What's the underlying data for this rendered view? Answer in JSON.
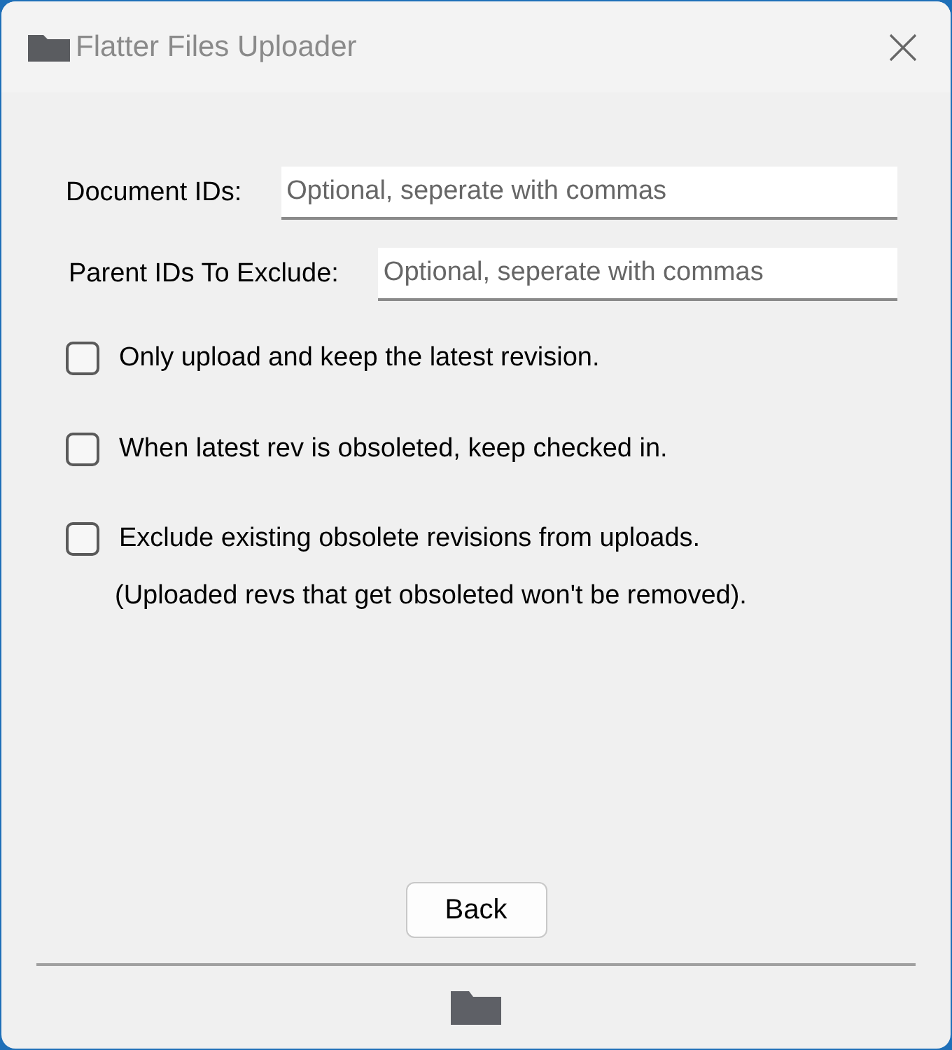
{
  "window": {
    "title": "Flatter Files Uploader"
  },
  "fields": [
    {
      "label": "Document IDs:",
      "placeholder": "Optional, seperate with commas"
    },
    {
      "label": "Parent IDs To Exclude:",
      "placeholder": "Optional, seperate with commas"
    }
  ],
  "options": [
    {
      "label": "Only upload and keep the latest revision.",
      "checked": false
    },
    {
      "label": "When latest rev is obsoleted, keep checked in.",
      "checked": false
    },
    {
      "label": "Exclude existing obsolete revisions from uploads.",
      "note": "(Uploaded revs that get obsoleted won't be removed).",
      "checked": false
    }
  ],
  "buttons": [
    "Back"
  ]
}
